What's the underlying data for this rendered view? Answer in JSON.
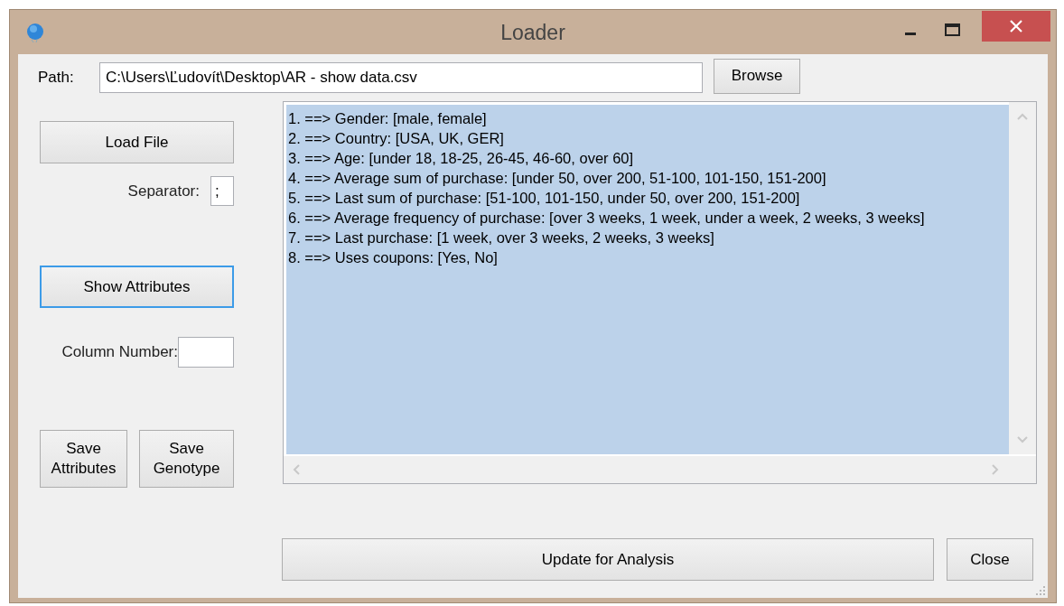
{
  "window": {
    "title": "Loader"
  },
  "path": {
    "label": "Path:",
    "value": "C:\\Users\\Ľudovít\\Desktop\\AR - show data.csv"
  },
  "browse_button": "Browse",
  "load_button": "Load File",
  "separator": {
    "label": "Separator:",
    "value": ";"
  },
  "show_button": {
    "label": "Show Attributes",
    "focused": true
  },
  "column_number": {
    "label": "Column Number:"
  },
  "save_buttons": [
    "Save Attributes",
    "Save Genotype"
  ],
  "output": {
    "selected": true,
    "lines": [
      "1. ==> Gender: [male, female]",
      "2. ==> Country: [USA, UK, GER]",
      "3. ==> Age: [under 18, 18-25, 26-45, 46-60, over 60]",
      "4. ==> Average sum of purchase: [under 50, over 200, 51-100, 101-150, 151-200]",
      "5. ==> Last sum of purchase: [51-100, 101-150, under 50, over 200, 151-200]",
      "6. ==> Average frequency of purchase: [over 3 weeks, 1 week, under a week, 2 weeks, 3 weeks]",
      "7. ==> Last purchase: [1 week, over 3 weeks, 2 weeks, 3 weeks]",
      "8. ==> Uses coupons: [Yes, No]"
    ]
  },
  "update_button": "Update for Analysis",
  "close_button": "Close"
}
